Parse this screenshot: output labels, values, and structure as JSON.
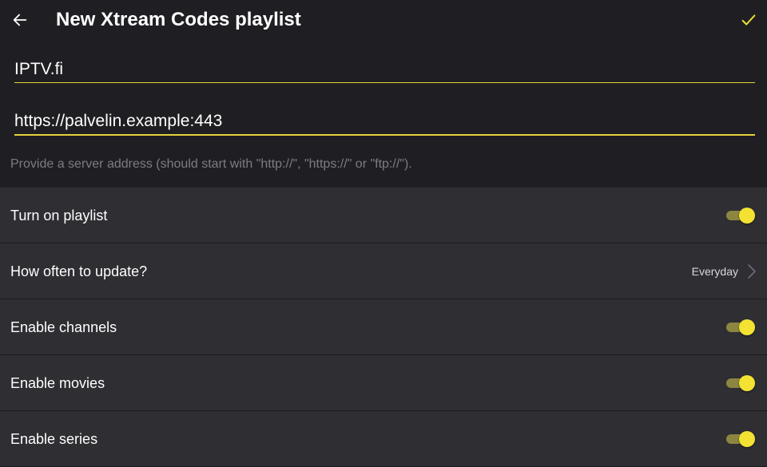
{
  "appbar": {
    "title": "New Xtream Codes playlist"
  },
  "form": {
    "name_value": "IPTV.fi",
    "url_value": "https://palvelin.example:443",
    "hint": "Provide a server address (should start with \"http://\", \"https://\" or \"ftp://\")."
  },
  "settings": {
    "items": [
      {
        "label": "Turn on playlist",
        "type": "toggle",
        "on": true
      },
      {
        "label": "How often to update?",
        "type": "select",
        "value": "Everyday"
      },
      {
        "label": "Enable channels",
        "type": "toggle",
        "on": true
      },
      {
        "label": "Enable movies",
        "type": "toggle",
        "on": true
      },
      {
        "label": "Enable series",
        "type": "toggle",
        "on": true
      }
    ]
  },
  "colors": {
    "accent": "#f4e233",
    "track": "#8c8640",
    "background": "#232327",
    "row": "#2e2e33",
    "hint": "#7c7c82"
  },
  "icons": {
    "back": "arrow-left-icon",
    "confirm": "check-icon",
    "chevron": "chevron-right-icon"
  }
}
